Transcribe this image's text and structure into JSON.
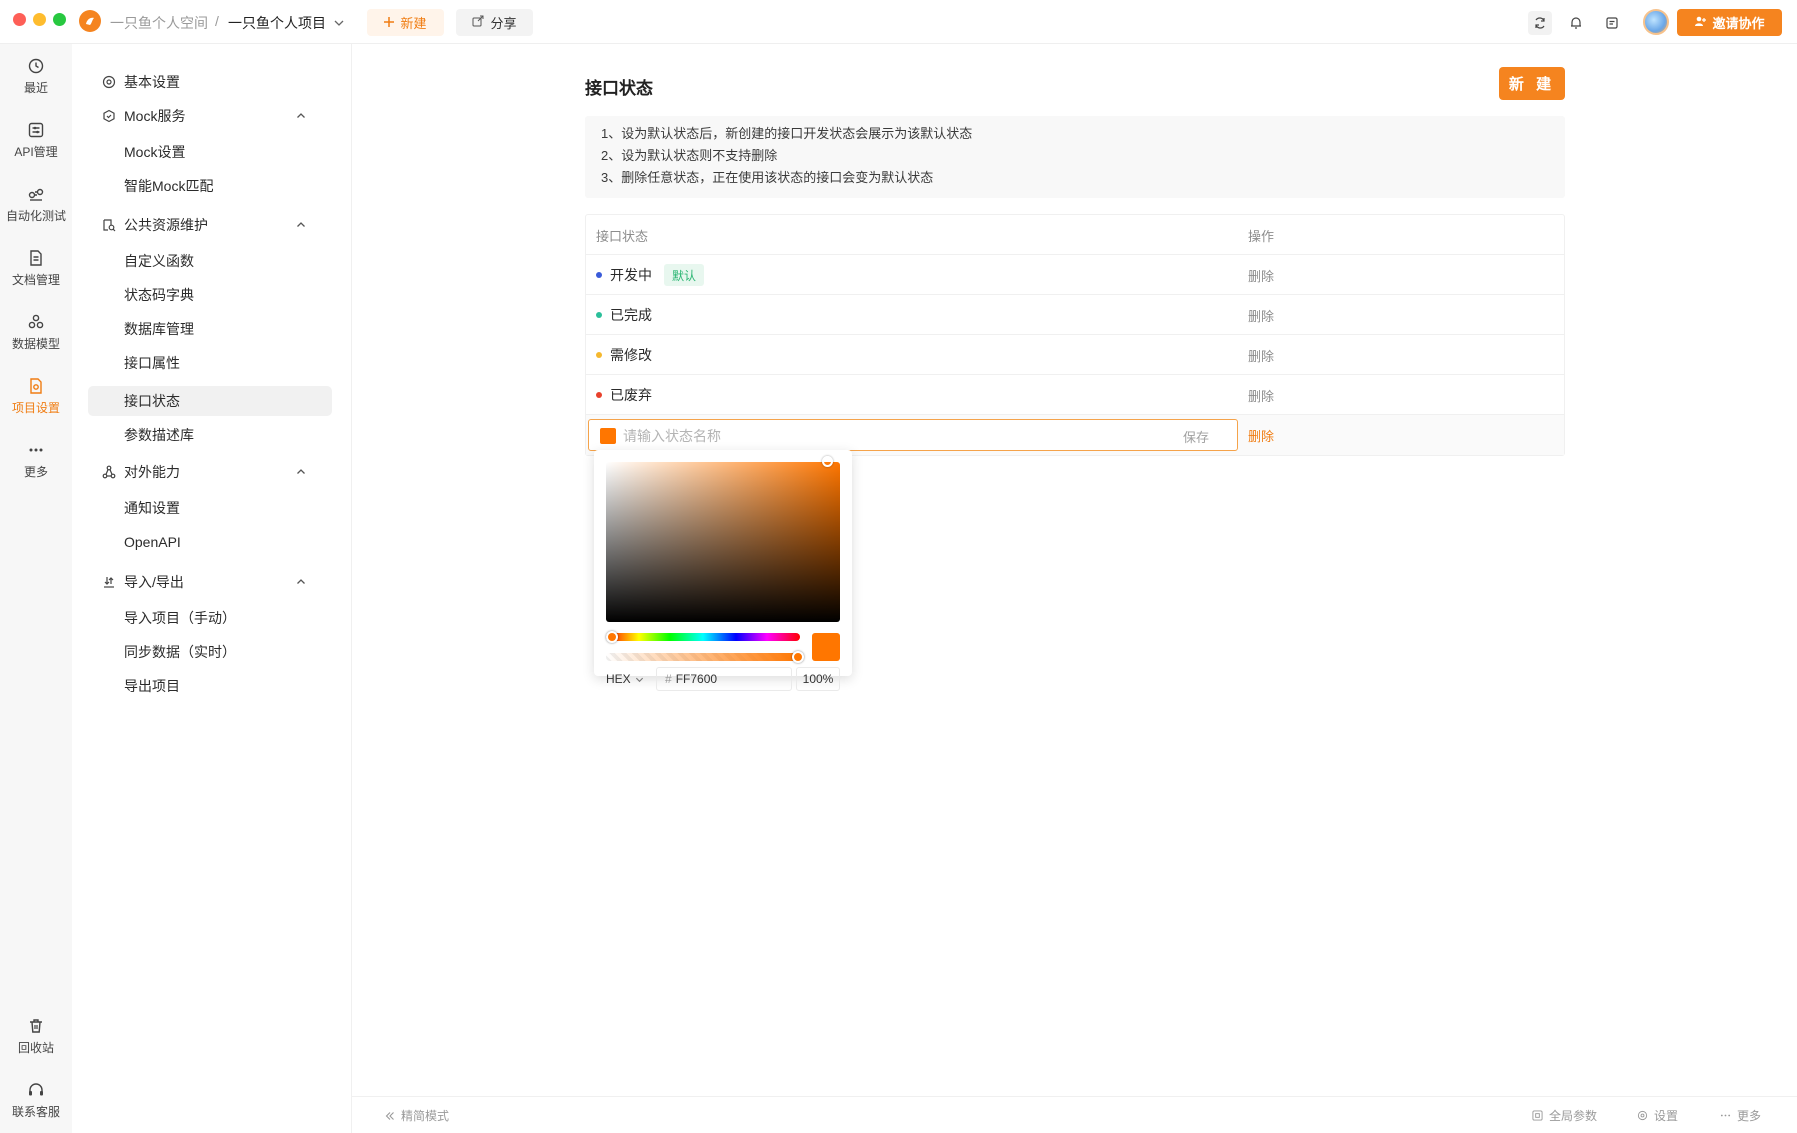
{
  "titlebar": {
    "space": "一只鱼个人空间",
    "separator": "/",
    "project": "一只鱼个人项目",
    "new_label": "新建",
    "share_label": "分享",
    "invite_label": "邀请协作"
  },
  "rail": {
    "items": [
      {
        "label": "最近",
        "icon": "history-icon"
      },
      {
        "label": "API管理",
        "icon": "api-icon"
      },
      {
        "label": "自动化测试",
        "icon": "automation-icon"
      },
      {
        "label": "文档管理",
        "icon": "document-icon"
      },
      {
        "label": "数据模型",
        "icon": "data-model-icon"
      },
      {
        "label": "项目设置",
        "icon": "project-settings-icon",
        "active": true
      },
      {
        "label": "更多",
        "icon": "more-icon"
      }
    ],
    "bottom": [
      {
        "label": "回收站",
        "icon": "trash-icon"
      },
      {
        "label": "联系客服",
        "icon": "headset-icon"
      }
    ]
  },
  "subnav": {
    "basic": "基本设置",
    "mock": {
      "label": "Mock服务",
      "items": [
        "Mock设置",
        "智能Mock匹配"
      ]
    },
    "public": {
      "label": "公共资源维护",
      "items": [
        "自定义函数",
        "状态码字典",
        "数据库管理",
        "接口属性",
        "接口状态",
        "参数描述库"
      ]
    },
    "external": {
      "label": "对外能力",
      "items": [
        "通知设置",
        "OpenAPI"
      ]
    },
    "io": {
      "label": "导入/导出",
      "items": [
        "导入项目（手动）",
        "同步数据（实时）",
        "导出项目"
      ]
    }
  },
  "main": {
    "title": "接口状态",
    "new_button": "新 建",
    "tips": [
      "1、设为默认状态后，新创建的接口开发状态会展示为该默认状态",
      "2、设为默认状态则不支持删除",
      "3、删除任意状态，正在使用该状态的接口会变为默认状态"
    ],
    "table": {
      "headers": [
        "接口状态",
        "操作"
      ],
      "rows": [
        {
          "name": "开发中",
          "color": "#3a5bd9",
          "tag": "默认",
          "action": "删除"
        },
        {
          "name": "已完成",
          "color": "#2bbf9a",
          "action": "删除"
        },
        {
          "name": "需修改",
          "color": "#f5b82e",
          "action": "删除"
        },
        {
          "name": "已废弃",
          "color": "#e8412c",
          "action": "删除"
        }
      ],
      "editing": {
        "placeholder": "请输入状态名称",
        "value": "",
        "save": "保存",
        "delete": "删除",
        "color": "#ff7600"
      }
    }
  },
  "picker": {
    "mode": "HEX",
    "hash": "#",
    "hex": "FF7600",
    "alpha": "100%",
    "color": "#ff7600"
  },
  "footer": {
    "simple_mode": "精简模式",
    "global_params": "全局参数",
    "settings": "设置",
    "more": "更多"
  },
  "colors": {
    "accent": "#f5841f",
    "default_tag_bg": "#e8f7ef",
    "default_tag_text": "#2bb673"
  }
}
